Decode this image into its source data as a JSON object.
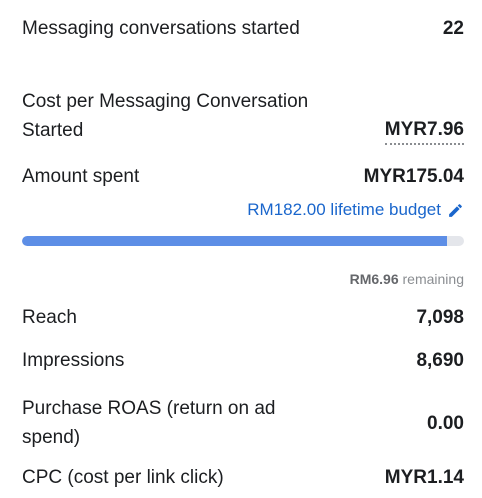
{
  "metrics": {
    "messaging_started": {
      "label": "Messaging conversations started",
      "value": "22"
    },
    "cost_per_messaging": {
      "label": "Cost per Messaging Conversation Started",
      "value": "MYR7.96"
    },
    "amount_spent": {
      "label": "Amount spent",
      "value": "MYR175.04"
    },
    "reach": {
      "label": "Reach",
      "value": "7,098"
    },
    "impressions": {
      "label": "Impressions",
      "value": "8,690"
    },
    "purchase_roas": {
      "label": "Purchase ROAS (return on ad spend)",
      "value": "0.00"
    },
    "cpc": {
      "label": "CPC (cost per link click)",
      "value": "MYR1.14"
    }
  },
  "budget": {
    "text": "RM182.00 lifetime budget",
    "icon": "pencil-icon",
    "spent_fraction": 0.962,
    "remaining_amount": "RM6.96",
    "remaining_label": "remaining"
  },
  "colors": {
    "link": "#1a66cc",
    "progress_fill": "#5d8ee6",
    "progress_track": "#e4e6eb",
    "muted": "#8a8d91"
  }
}
